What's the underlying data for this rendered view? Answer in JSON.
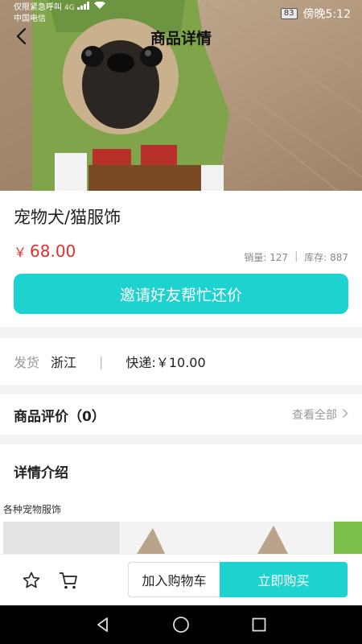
{
  "status_bar": {
    "emergency_text": "仅限紧急呼叫",
    "carrier": "中国电信",
    "network": "4G",
    "battery": "83",
    "time": "傍晚5:12"
  },
  "header": {
    "title": "商品详情",
    "back_icon": "chevron-left-icon"
  },
  "product": {
    "name": "宠物犬/猫服饰",
    "currency": "￥",
    "price": "68.00",
    "sales_label": "销量: 127",
    "stock_label": "库存: 887",
    "stats_separator": "|"
  },
  "bargain_button": {
    "label": "邀请好友帮忙还价"
  },
  "shipping": {
    "from_label": "发货",
    "from_value": "浙江",
    "separator": "|",
    "express_label": "快递: ",
    "express_value": "￥10.00"
  },
  "reviews": {
    "title": "商品评价（0）",
    "view_all": "查看全部"
  },
  "details": {
    "title": "详情介绍",
    "description": "各种宠物服饰"
  },
  "action_bar": {
    "favorite_icon": "star-outline-icon",
    "cart_icon": "shopping-cart-icon",
    "add_to_cart": "加入购物车",
    "buy_now": "立即购买"
  },
  "colors": {
    "accent": "#1ed3cf",
    "price": "#e02f2f",
    "section_gap": "#f1f3f4"
  }
}
